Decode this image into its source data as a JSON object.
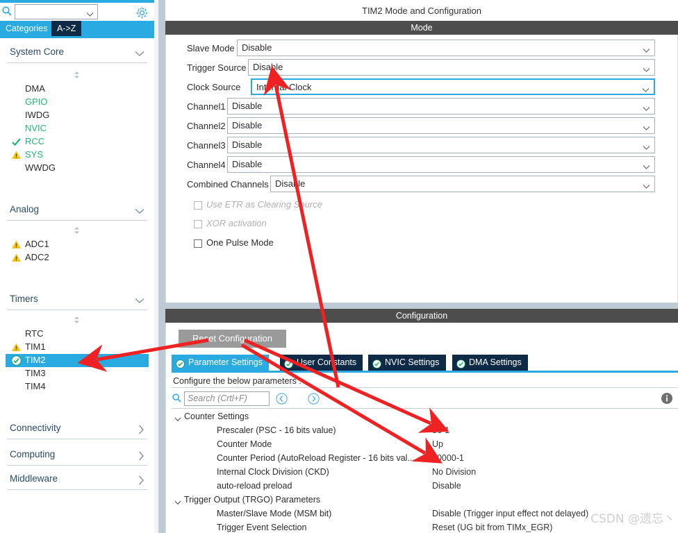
{
  "left_panel": {
    "search": {
      "value": "",
      "placeholder": ""
    },
    "gear_icon": "gear-icon",
    "tabs": [
      {
        "label": "Categories",
        "active": true
      },
      {
        "label": "A->Z",
        "active": false
      }
    ],
    "groups": [
      {
        "label": "System Core",
        "expanded": true,
        "items": [
          {
            "label": "DMA",
            "status": "none"
          },
          {
            "label": "GPIO",
            "status": "configured"
          },
          {
            "label": "IWDG",
            "status": "none"
          },
          {
            "label": "NVIC",
            "status": "configured"
          },
          {
            "label": "RCC",
            "status": "check"
          },
          {
            "label": "SYS",
            "status": "warn"
          },
          {
            "label": "WWDG",
            "status": "none"
          }
        ]
      },
      {
        "label": "Analog",
        "expanded": true,
        "items": [
          {
            "label": "ADC1",
            "status": "warn"
          },
          {
            "label": "ADC2",
            "status": "warn"
          }
        ]
      },
      {
        "label": "Timers",
        "expanded": true,
        "items": [
          {
            "label": "RTC",
            "status": "none"
          },
          {
            "label": "TIM1",
            "status": "warn"
          },
          {
            "label": "TIM2",
            "status": "ok",
            "selected": true
          },
          {
            "label": "TIM3",
            "status": "none"
          },
          {
            "label": "TIM4",
            "status": "none"
          }
        ]
      },
      {
        "label": "Connectivity",
        "expanded": false,
        "items": []
      },
      {
        "label": "Computing",
        "expanded": false,
        "items": []
      },
      {
        "label": "Middleware",
        "expanded": false,
        "items": []
      }
    ]
  },
  "mode_panel": {
    "title": "TIM2 Mode and Configuration",
    "band_label": "Mode",
    "rows": [
      {
        "label": "Slave Mode",
        "value": "Disable",
        "focused": false
      },
      {
        "label": "Trigger Source",
        "value": "Disable",
        "focused": false
      },
      {
        "label": "Clock Source",
        "value": "Internal Clock",
        "focused": true
      },
      {
        "label": "Channel1",
        "value": "Disable",
        "focused": false
      },
      {
        "label": "Channel2",
        "value": "Disable",
        "focused": false
      },
      {
        "label": "Channel3",
        "value": "Disable",
        "focused": false
      },
      {
        "label": "Channel4",
        "value": "Disable",
        "focused": false
      },
      {
        "label": "Combined Channels",
        "value": "Disable",
        "focused": false
      }
    ],
    "checkboxes": [
      {
        "label": "Use ETR as Clearing Source",
        "checked": false,
        "disabled": true
      },
      {
        "label": "XOR activation",
        "checked": false,
        "disabled": true
      },
      {
        "label": "One Pulse Mode",
        "checked": false,
        "disabled": false
      }
    ]
  },
  "config_panel": {
    "band_label": "Configuration",
    "reset_label": "Reset Configuration",
    "tabs": [
      {
        "label": "Parameter Settings",
        "active": true
      },
      {
        "label": "User Constants",
        "active": false
      },
      {
        "label": "NVIC Settings",
        "active": false
      },
      {
        "label": "DMA Settings",
        "active": false
      }
    ],
    "note": "Configure the below parameters :",
    "search_placeholder": "Search (Crtl+F)",
    "prev_label": "prev-match-icon",
    "next_label": "next-match-icon",
    "info_label": "info-icon",
    "param_rows": [
      {
        "type": "group",
        "name": "Counter Settings",
        "value": "",
        "expanded": true
      },
      {
        "type": "param",
        "name": "Prescaler (PSC - 16 bits value)",
        "value": "36-1"
      },
      {
        "type": "param",
        "name": "Counter Mode",
        "value": "Up"
      },
      {
        "type": "param",
        "name": "Counter Period (AutoReload Register - 16 bits val...",
        "value": "60000-1"
      },
      {
        "type": "param",
        "name": "Internal Clock Division (CKD)",
        "value": "No Division"
      },
      {
        "type": "param",
        "name": "auto-reload preload",
        "value": "Disable"
      },
      {
        "type": "group",
        "name": "Trigger Output (TRGO) Parameters",
        "value": "",
        "expanded": true
      },
      {
        "type": "param",
        "name": "Master/Slave Mode (MSM bit)",
        "value": "Disable (Trigger input effect not delayed)"
      },
      {
        "type": "param",
        "name": "Trigger Event Selection",
        "value": "Reset (UG bit from TIMx_EGR)"
      }
    ]
  },
  "annotations": {
    "arrow_color": "#ee2222",
    "count": 4
  },
  "watermark": {
    "text": "CSDN @遗忘丶"
  },
  "colors": {
    "accent_blue": "#29abe2",
    "tab_navy": "#0e2a47",
    "band_gray": "#4d4d4d",
    "divider": "#bfcbd4",
    "green": "#22b573",
    "warn_yellow": "#f5c518",
    "arrow_red": "#ee2222"
  }
}
